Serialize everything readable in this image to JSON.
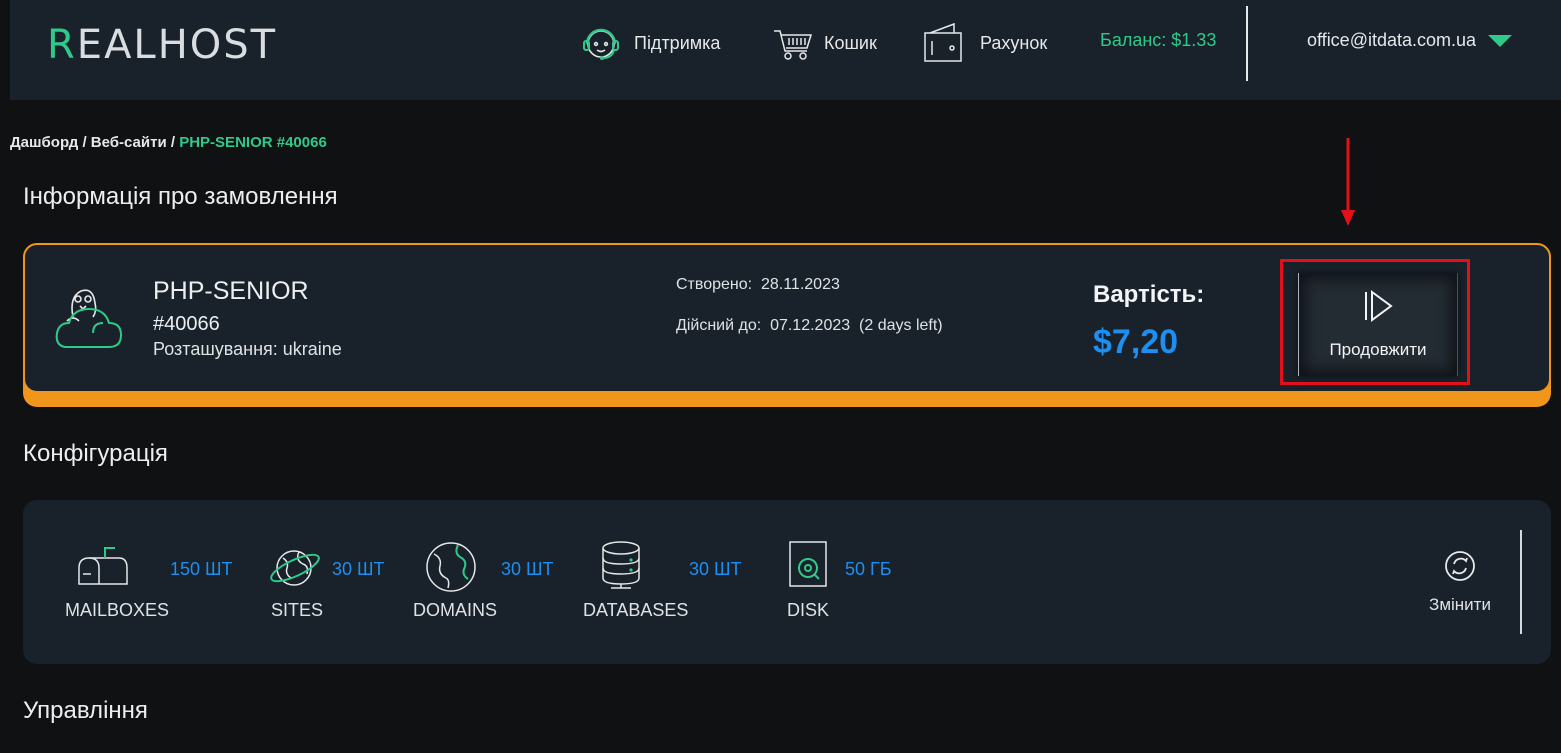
{
  "header": {
    "logo": "REALHOST",
    "nav": [
      {
        "label": "Підтримка",
        "icon": "support-headset-icon"
      },
      {
        "label": "Кошик",
        "icon": "cart-icon"
      },
      {
        "label": "Рахунок",
        "icon": "wallet-icon"
      }
    ],
    "balance": "Баланс: $1.33",
    "account_email": "office@itdata.com.ua"
  },
  "breadcrumb": {
    "items": [
      "Дашборд",
      "Веб-сайти"
    ],
    "separator": " / ",
    "current": "PHP-SENIOR #40066"
  },
  "sections": {
    "order_info": "Інформація про замовлення",
    "configuration": "Конфігурація",
    "management": "Управління"
  },
  "order": {
    "plan": "PHP-SENIOR",
    "id": "#40066",
    "location": "Розташування: ukraine",
    "created_label": "Створено:",
    "created_value": "28.11.2023",
    "valid_label": "Дійсний до:",
    "valid_value": "07.12.2023",
    "days_left": "(2 days left)",
    "price_label": "Вартість:",
    "price_value": "$7,20",
    "renew_label": "Продовжити"
  },
  "configuration": {
    "items": [
      {
        "label": "MAILBOXES",
        "value": "150 ШТ",
        "icon": "mailbox-icon"
      },
      {
        "label": "SITES",
        "value": "30 ШТ",
        "icon": "planet-icon"
      },
      {
        "label": "DOMAINS",
        "value": "30 ШТ",
        "icon": "globe-icon"
      },
      {
        "label": "DATABASES",
        "value": "30 ШТ",
        "icon": "database-icon"
      },
      {
        "label": "DISK",
        "value": "50 ГБ",
        "icon": "disk-icon"
      }
    ],
    "change_label": "Змінити"
  },
  "colors": {
    "accent_green": "#2fc98a",
    "accent_blue": "#1e8ff0",
    "accent_orange": "#f0961a",
    "highlight_red": "#e3101a",
    "panel": "#19222b",
    "background": "#101112"
  }
}
